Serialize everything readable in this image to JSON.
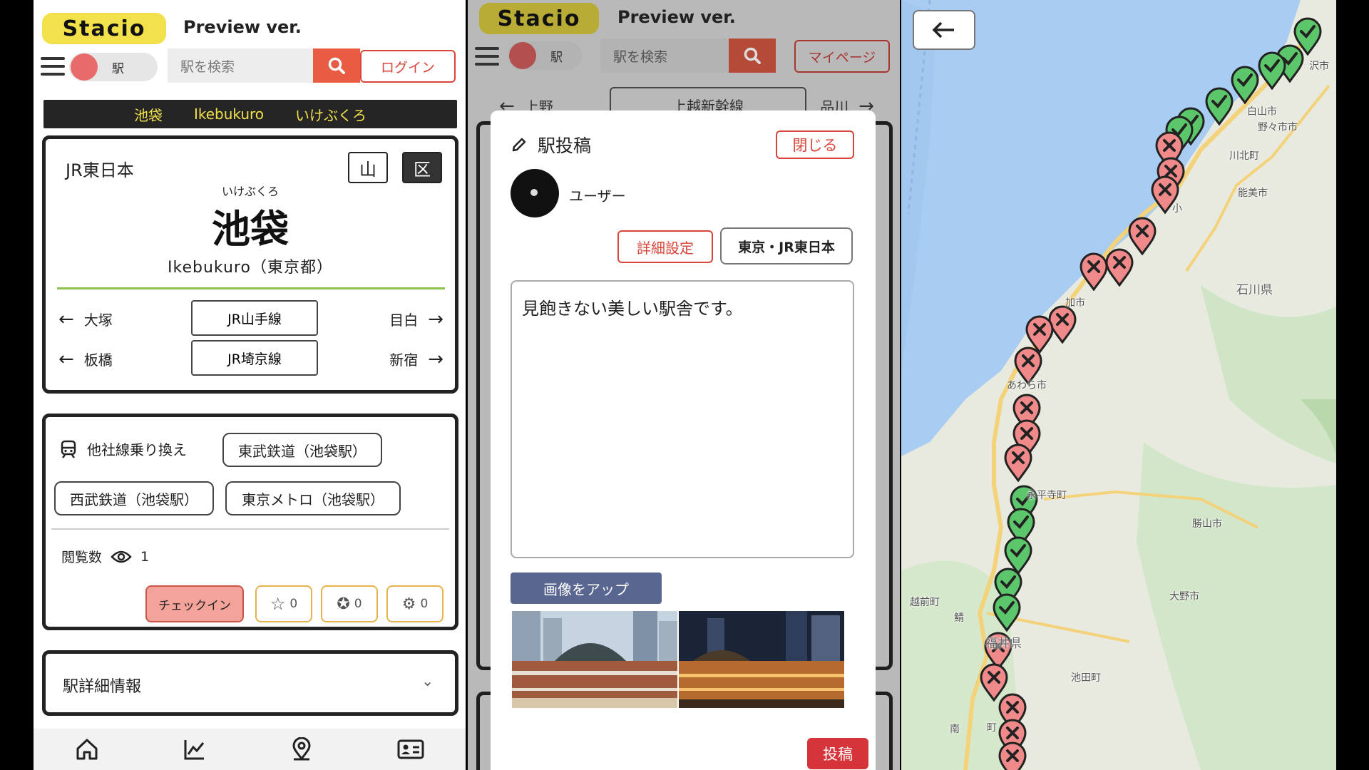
{
  "header": {
    "logo": "Stacio",
    "preview": "Preview ver.",
    "toggle_label": "駅",
    "search_placeholder": "駅を検索",
    "login_label": "ログイン",
    "mypage_label": "マイページ"
  },
  "station": {
    "bar_kanji": "池袋",
    "bar_roman": "Ikebukuro",
    "bar_kana": "いけぶくろ",
    "company": "JR東日本",
    "badge_yama": "山",
    "badge_ku": "区",
    "furigana": "いけぶくろ",
    "name": "池袋",
    "roman_line": "Ikebukuro（東京都）",
    "lines": [
      {
        "prev": "大塚",
        "line": "JR山手線",
        "next": "目白"
      },
      {
        "prev": "板橋",
        "line": "JR埼京線",
        "next": "新宿"
      }
    ],
    "transfer_label": "他社線乗り換え",
    "transfers": [
      "東武鉄道（池袋駅）",
      "西武鉄道（池袋駅）",
      "東京メトロ（池袋駅）"
    ],
    "views_label": "閲覧数",
    "views_count": "1",
    "checkin_label": "チェックイン",
    "ratings": [
      "0",
      "0",
      "0"
    ],
    "details_label": "駅詳細情報"
  },
  "post": {
    "tab_prev": "上野",
    "tab_current": "上越新幹線",
    "tab_next": "品川",
    "title": "駅投稿",
    "close_label": "閉じる",
    "user": "ユーザー",
    "settings_label": "詳細設定",
    "station_tag": "東京・JR東日本",
    "text": "見飽きない美しい駅舎です。",
    "upload_label": "画像をアップ",
    "submit_label": "投稿"
  },
  "map": {
    "labels": [
      "沢市",
      "白山市",
      "野々市市",
      "川北町",
      "能美市",
      "石川県",
      "小",
      "加",
      "市",
      "あわら市",
      "永平寺町",
      "勝山市",
      "越前町",
      "大野市",
      "福井県",
      "池田町",
      "鯖",
      "町",
      "南"
    ],
    "colors": {
      "sea": "#a9cdf2",
      "land": "#e8eadf",
      "route": "#f3d27a",
      "visited": "#5cc66b",
      "unvisited": "#f08a8a"
    }
  }
}
